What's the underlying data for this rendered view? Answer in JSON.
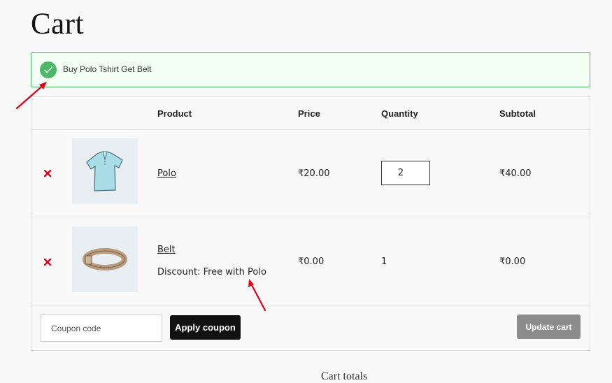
{
  "page": {
    "title": "Cart"
  },
  "notice": {
    "message": "Buy Polo Tshirt Get Belt"
  },
  "table": {
    "headers": {
      "product": "Product",
      "price": "Price",
      "quantity": "Quantity",
      "subtotal": "Subtotal"
    },
    "items": [
      {
        "name": "Polo",
        "price": "₹20.00",
        "quantity": "2",
        "subtotal": "₹40.00",
        "thumb_icon": "polo-shirt-image"
      },
      {
        "name": "Belt",
        "meta": "Discount: Free with Polo",
        "price": "₹0.00",
        "quantity": "1",
        "subtotal": "₹0.00",
        "thumb_icon": "belt-image"
      }
    ]
  },
  "coupon": {
    "placeholder": "Coupon code",
    "apply_label": "Apply coupon"
  },
  "update": {
    "label": "Update cart"
  },
  "totals": {
    "title": "Cart totals"
  },
  "colors": {
    "notice_border": "#4ab866",
    "remove": "#e2001a",
    "arrow": "#e2001a",
    "apply_bg": "#111111",
    "update_bg": "#8c8c8c"
  }
}
